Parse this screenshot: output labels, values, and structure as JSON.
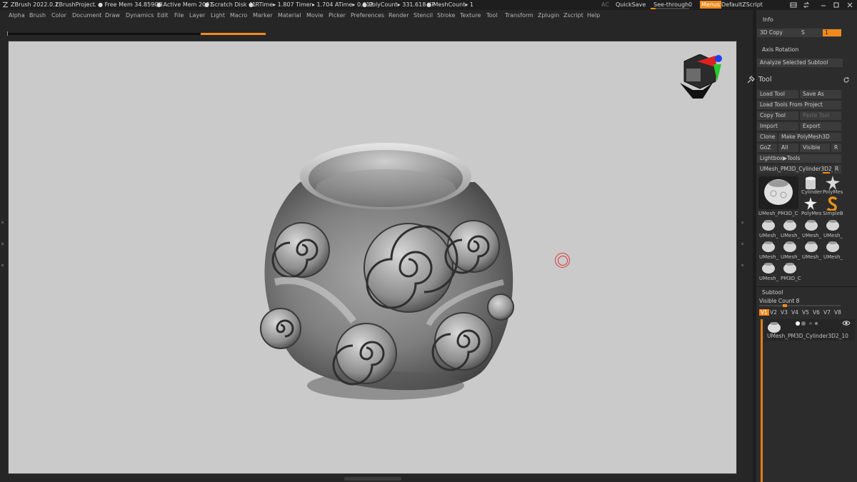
{
  "titlebar": {
    "app": "ZBrush 2022.0.1",
    "project": "ZBrushProject",
    "free_mem": ". ● Free Mem 34.859GB",
    "active_mem": "● Active Mem 2001",
    "scratch": "● Scratch Disk 41",
    "rtime": "●  RTime▸ 1.807 Timer▸ 1.704 ATime▸ 0.612",
    "polycount": "● PolyCount▸ 331.618 KP",
    "meshcount": "● MeshCount▸ 1",
    "ac": "AC",
    "quicksave": "QuickSave",
    "see_through": "See-through",
    "see_through_value": "0",
    "menus": "Menus",
    "default_zscript": "DefaultZScript"
  },
  "menus": [
    "Alpha",
    "Brush",
    "Color",
    "Document",
    "Draw",
    "Dynamics",
    "Edit",
    "File",
    "Layer",
    "Light",
    "Macro",
    "Marker",
    "Material",
    "Movie",
    "Picker",
    "Preferences",
    "Render",
    "Stencil",
    "Stroke",
    "Texture",
    "Tool",
    "Transform",
    "Zplugin",
    "Zscript",
    "Help"
  ],
  "timeline_progress": 0.25,
  "right_panel": {
    "info": "Info",
    "copy3d": "3D Copy",
    "s_label": "S",
    "s_value": "1",
    "axis_rotation": "Axis Rotation",
    "analyze": "Analyze Selected Subtool",
    "tool_title": "Tool",
    "buttons": {
      "load_tool": "Load Tool",
      "save_as": "Save As",
      "load_from_project": "Load Tools From Project",
      "copy_tool": "Copy Tool",
      "paste_tool": "Paste Tool",
      "import": "Import",
      "export": "Export",
      "clone": "Clone",
      "make_polymesh": "Make PolyMesh3D",
      "goz": "GoZ",
      "all": "All",
      "visible": "Visible",
      "r": "R",
      "lightbox_tools": "Lightbox▶Tools",
      "current_tool": "UMesh_PM3D_Cylinder3D2_1",
      "current_tool_r": "R"
    },
    "tools": {
      "main": "UMesh_PM3D_C",
      "cylinder": "Cylinder",
      "polymesh_a": "PolyMes",
      "polymesh_b": "PolyMes",
      "simpleb": "SimpleB",
      "grid": [
        "UMesh_",
        "UMesh_",
        "UMesh_",
        "UMesh_",
        "UMesh_",
        "UMesh_",
        "UMesh_",
        "UMesh_",
        "UMesh_",
        "PM3D_C"
      ]
    },
    "subtool": "Subtool",
    "visible_count_label": "Visible Count",
    "visible_count": "8",
    "visibility_sets": [
      "V1",
      "V2",
      "V3",
      "V4",
      "V5",
      "V6",
      "V7",
      "V8"
    ],
    "subtool_name": "UMesh_PM3D_Cylinder3D2_10"
  },
  "colors": {
    "accent": "#f08a1c",
    "viewport_bg": "#cacaca",
    "panel_bg": "#2c2c2c"
  }
}
